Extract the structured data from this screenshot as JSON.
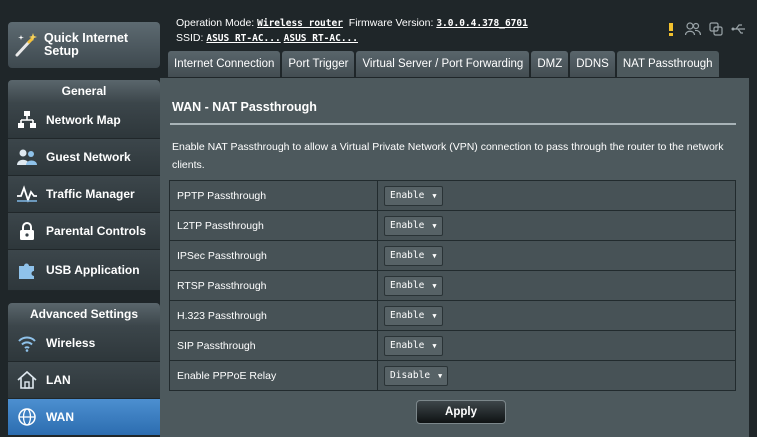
{
  "sidebar": {
    "quick_setup": "Quick Internet Setup",
    "general_title": "General",
    "general_items": [
      {
        "label": "Network Map",
        "icon": "network-map-icon"
      },
      {
        "label": "Guest Network",
        "icon": "guest-network-icon"
      },
      {
        "label": "Traffic Manager",
        "icon": "traffic-manager-icon"
      },
      {
        "label": "Parental Controls",
        "icon": "lock-icon"
      },
      {
        "label": "USB Application",
        "icon": "puzzle-icon"
      }
    ],
    "advanced_title": "Advanced Settings",
    "advanced_items": [
      {
        "label": "Wireless",
        "icon": "wifi-icon"
      },
      {
        "label": "LAN",
        "icon": "home-icon"
      },
      {
        "label": "WAN",
        "icon": "globe-icon",
        "active": true
      }
    ]
  },
  "header": {
    "op_mode_label": "Operation Mode:",
    "op_mode_value": "Wireless router",
    "firmware_label": "Firmware Version:",
    "firmware_value": "3.0.0.4.378_6701",
    "ssid_label": "SSID:",
    "ssid_values": [
      "ASUS RT-AC...",
      "ASUS RT-AC..."
    ],
    "icons": [
      "warning-icon",
      "users-icon",
      "copy-icon",
      "usb-icon"
    ]
  },
  "tabs": [
    {
      "label": "Internet Connection"
    },
    {
      "label": "Port Trigger"
    },
    {
      "label": "Virtual Server / Port Forwarding"
    },
    {
      "label": "DMZ"
    },
    {
      "label": "DDNS"
    },
    {
      "label": "NAT Passthrough",
      "active": true
    }
  ],
  "main": {
    "title": "WAN - NAT Passthrough",
    "description": "Enable NAT Passthrough to allow a Virtual Private Network (VPN) connection to pass through the router to the network clients.",
    "rows": [
      {
        "label": "PPTP Passthrough",
        "value": "Enable"
      },
      {
        "label": "L2TP Passthrough",
        "value": "Enable"
      },
      {
        "label": "IPSec Passthrough",
        "value": "Enable"
      },
      {
        "label": "RTSP Passthrough",
        "value": "Enable"
      },
      {
        "label": "H.323 Passthrough",
        "value": "Enable"
      },
      {
        "label": "SIP Passthrough",
        "value": "Enable"
      },
      {
        "label": "Enable PPPoE Relay",
        "value": "Disable"
      }
    ],
    "apply_label": "Apply"
  },
  "colors": {
    "accent": "#2c6db0",
    "content_bg": "#4d595d",
    "page_bg": "#1f2629",
    "warning": "#f2c12e"
  }
}
